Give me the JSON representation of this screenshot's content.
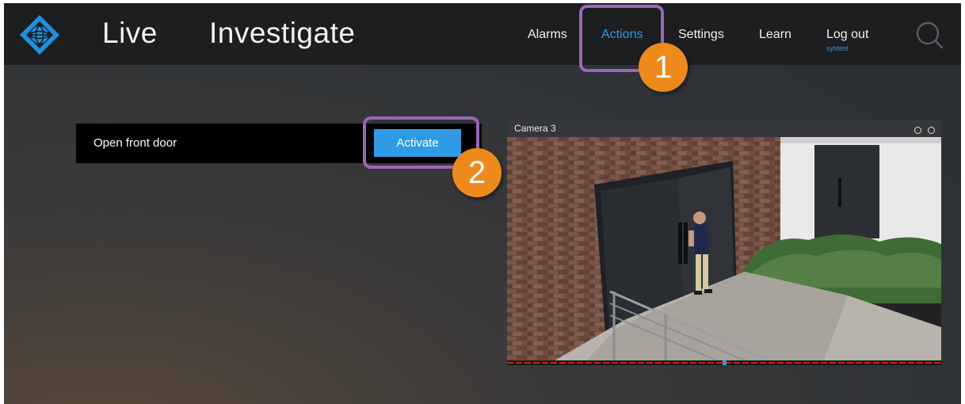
{
  "header": {
    "nav_primary": [
      "Live",
      "Investigate"
    ],
    "nav_secondary": {
      "alarms": "Alarms",
      "actions": "Actions",
      "settings": "Settings",
      "learn": "Learn",
      "logout": "Log out",
      "username": "systest"
    },
    "active_tab": "Actions",
    "accent_color": "#2d9be4"
  },
  "actions": {
    "items": [
      {
        "label": "Open front door",
        "button_label": "Activate"
      }
    ]
  },
  "camera": {
    "title": "Camera 3"
  },
  "callouts": {
    "colors": {
      "highlight": "#9a66b7",
      "badge": "#ee8a1c"
    },
    "items": [
      {
        "number": "1",
        "target": "Actions"
      },
      {
        "number": "2",
        "target": "Activate"
      }
    ]
  }
}
